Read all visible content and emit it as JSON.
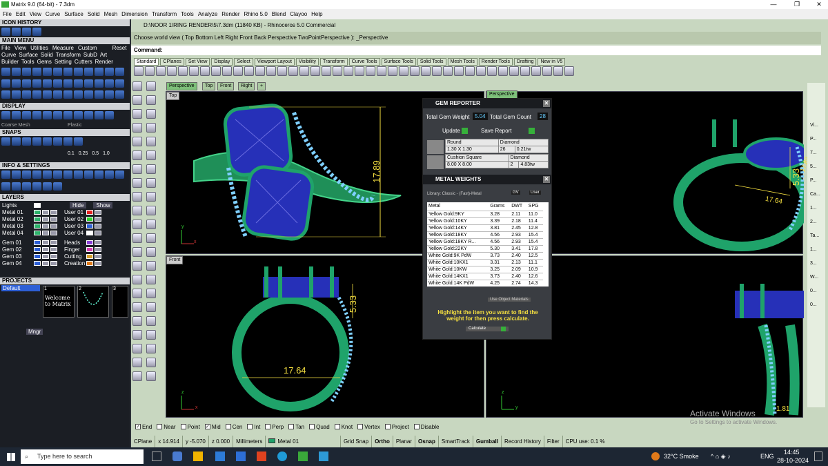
{
  "window": {
    "title": "Matrix 9.0 (64-bit) - 7.3dm",
    "min": "—",
    "max": "❐",
    "close": "✕"
  },
  "menu": [
    "File",
    "Edit",
    "View",
    "Curve",
    "Surface",
    "Solid",
    "Mesh",
    "Dimension",
    "Transform",
    "Tools",
    "Analyze",
    "Render",
    "Rhino 5.0",
    "Blend",
    "Clayoo",
    "Help"
  ],
  "left": {
    "icon_history": "ICON HISTORY",
    "main_menu": "MAIN MENU",
    "main_menu_row1": [
      "File",
      "View",
      "Utilities",
      "Measure",
      "Custom",
      "Reset"
    ],
    "main_menu_row2": [
      "Curve",
      "Surface",
      "Solid",
      "Transform",
      "SubD",
      "Art"
    ],
    "main_menu_row3": [
      "Builder",
      "Tools",
      "Gems",
      "Setting",
      "Cutters",
      "Render"
    ],
    "display": "DISPLAY",
    "display_modes": [
      "Coarse Mesh",
      "Plastic"
    ],
    "snaps": "SNAPS",
    "snap_values": [
      "0.1",
      "0.25",
      "0.5",
      "1.0"
    ],
    "info": "INFO & SETTINGS",
    "layers": "LAYERS",
    "layers_hide": "Hide",
    "layers_show": "Show",
    "layer_rows": [
      {
        "a": "Lights",
        "b": ""
      },
      {
        "a": "Metal 01",
        "b": "User 01"
      },
      {
        "a": "Metal 02",
        "b": "User 02"
      },
      {
        "a": "Metal 03",
        "b": "User 03"
      },
      {
        "a": "Metal 04",
        "b": "User 04"
      },
      {
        "a": "Gem 01",
        "b": "Heads"
      },
      {
        "a": "Gem 02",
        "b": "Finger"
      },
      {
        "a": "Gem 03",
        "b": "Cutting"
      },
      {
        "a": "Gem 04",
        "b": "Creation"
      }
    ],
    "layer_colors": [
      "#2db36b",
      "#2db36b",
      "#2db36b",
      "#2db36b",
      "#2d5fd6",
      "#2d5fd6",
      "#2d5fd6",
      "#2d5fd6"
    ],
    "user_colors": [
      "#e52121",
      "#2dd62d",
      "#2d5fd6",
      "#ffffff",
      "#8a3fd6",
      "#d63fb3",
      "#d6a02d",
      "#e07a1a"
    ],
    "projects": "PROJECTS",
    "project_default": "Default",
    "project_thumbs": [
      "1",
      "2",
      "3"
    ],
    "welcome": "Welcome to Matrix",
    "mngr": "Mngr"
  },
  "rhino": {
    "title": "D:\\NOOR 1\\RING RENDER\\5\\7.3dm (11840 KB) - Rhinoceros 5.0 Commercial",
    "cmd_history": "Choose world view ( Top  Bottom  Left  Right  Front  Back  Perspective  TwoPointPerspective ): _Perspective",
    "command_label": "Command:",
    "toolbar_tabs": [
      "Standard",
      "CPlanes",
      "Set View",
      "Display",
      "Select",
      "Viewport Layout",
      "Visibility",
      "Transform",
      "Curve Tools",
      "Surface Tools",
      "Solid Tools",
      "Mesh Tools",
      "Render Tools",
      "Drafting",
      "New in V5"
    ],
    "view_tabs": [
      "Perspective",
      "Top",
      "Front",
      "Right",
      "+"
    ],
    "vp_labels": {
      "top": "Top",
      "front": "Front",
      "perspective": "Perspective"
    },
    "dims": {
      "top_height": "17.89",
      "front_width": "17.64",
      "front_height": "5.33",
      "persp_a": "5.33",
      "persp_b": "17.64",
      "persp_c": "17.89",
      "right_width": "1.81"
    },
    "axes": {
      "x": "x",
      "y": "y",
      "z": "z"
    }
  },
  "gem_reporter": {
    "title": "GEM REPORTER",
    "total_weight_label": "Total Gem Weight",
    "total_weight": "5.04",
    "total_count_label": "Total Gem Count",
    "total_count": "28",
    "update": "Update",
    "save_report": "Save Report",
    "gems": [
      {
        "shape": "Round",
        "material": "Diamond",
        "size": "1.30 X 1.30",
        "count": "26",
        "weight": "0.21tw"
      },
      {
        "shape": "Cushion Square",
        "material": "Diamond",
        "size": "8.00 X 8.00",
        "count": "2",
        "weight": "4.83tw"
      }
    ]
  },
  "metal_weights": {
    "title": "METAL WEIGHTS",
    "library": "Library: Classic - (Fast)-Metal",
    "btn_gv": "GV",
    "btn_user": "User",
    "columns": [
      "Metal",
      "Grams",
      "DWT",
      "SPG"
    ],
    "rows": [
      [
        "Yellow Gold:9KY",
        "3.28",
        "2.11",
        "11.0"
      ],
      [
        "Yellow Gold:10KY",
        "3.39",
        "2.18",
        "11.4"
      ],
      [
        "Yellow Gold:14KY",
        "3.81",
        "2.45",
        "12.8"
      ],
      [
        "Yellow Gold:18KY",
        "4.56",
        "2.93",
        "15.4"
      ],
      [
        "Yellow Gold:18KY R...",
        "4.56",
        "2.93",
        "15.4"
      ],
      [
        "Yellow Gold:22KY",
        "5.30",
        "3.41",
        "17.8"
      ],
      [
        "White Gold:9K PdW",
        "3.73",
        "2.40",
        "12.5"
      ],
      [
        "White Gold:10KX1",
        "3.31",
        "2.13",
        "11.1"
      ],
      [
        "White Gold:10KW",
        "3.25",
        "2.09",
        "10.9"
      ],
      [
        "White Gold:14KX1",
        "3.73",
        "2.40",
        "12.6"
      ],
      [
        "White Gold:14K PdW",
        "4.25",
        "2.74",
        "14.3"
      ]
    ],
    "use_object_materials": "Use Object Materials",
    "hint": "Highlight the item you want to find the weight for then press calculate.",
    "calculate": "Calculate"
  },
  "osnaps": [
    {
      "label": "End",
      "checked": true
    },
    {
      "label": "Near",
      "checked": false
    },
    {
      "label": "Point",
      "checked": false
    },
    {
      "label": "Mid",
      "checked": true
    },
    {
      "label": "Cen",
      "checked": false
    },
    {
      "label": "Int",
      "checked": false
    },
    {
      "label": "Perp",
      "checked": false
    },
    {
      "label": "Tan",
      "checked": false
    },
    {
      "label": "Quad",
      "checked": false
    },
    {
      "label": "Knot",
      "checked": false
    },
    {
      "label": "Vertex",
      "checked": false
    },
    {
      "label": "Project",
      "checked": false
    },
    {
      "label": "Disable",
      "checked": false
    }
  ],
  "status": {
    "cplane": "CPlane",
    "x": "x 14.914",
    "y": "y -5.070",
    "z": "z 0.000",
    "units": "Millimeters",
    "layer": "Metal 01",
    "grid_snap": "Grid Snap",
    "ortho": "Ortho",
    "planar": "Planar",
    "osnap": "Osnap",
    "smarttrack": "SmartTrack",
    "gumball": "Gumball",
    "record_history": "Record History",
    "filter": "Filter",
    "cpu": "CPU use: 0.1 %"
  },
  "activate": {
    "line1": "Activate Windows",
    "line2": "Go to Settings to activate Windows."
  },
  "right_dock": [
    "Vi...",
    "P...",
    "7...",
    "5...",
    "P...",
    "Ca...",
    "1...",
    "2...",
    "Ta...",
    "1...",
    "3...",
    "W...",
    "0...",
    "0..."
  ],
  "taskbar": {
    "search": "Type here to search",
    "weather": "32°C  Smoke",
    "lang": "ENG",
    "time": "14:45",
    "date": "28-10-2024"
  },
  "colors": {
    "metal": "#1fa36a",
    "gem": "#2630b8",
    "dim": "#f6e040",
    "vp_bg": "#000000",
    "rhino_bg": "#c8d7c0"
  }
}
